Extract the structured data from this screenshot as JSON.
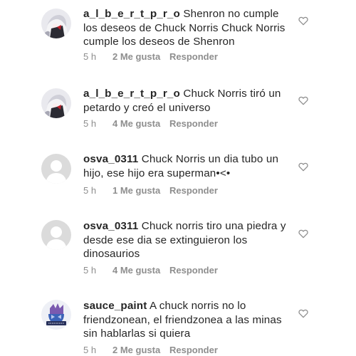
{
  "comments": [
    {
      "username": "a_l_b_e_r_t_p_r_o",
      "text": "Shenron no cumple los deseos de Chuck Norris Chuck Norris cumple los deseos de Shenron",
      "time": "5 h",
      "likes": "2 Me gusta",
      "reply": "Responder",
      "avatar": "anime-avatar"
    },
    {
      "username": "a_l_b_e_r_t_p_r_o",
      "text": "Chuck Norris tiró un petardo y creó el universo",
      "time": "5 h",
      "likes": "4 Me gusta",
      "reply": "Responder",
      "avatar": "anime-avatar"
    },
    {
      "username": "osva_0311",
      "text": "Chuck Norris un dia tubo un hijo, ese hijo era superman•<•",
      "time": "5 h",
      "likes": "1 Me gusta",
      "reply": "Responder",
      "avatar": "default-avatar"
    },
    {
      "username": "osva_0311",
      "text": "Chuck norris tiro una piedra y desde ese dia se extinguieron los dinosaurios",
      "time": "5 h",
      "likes": "4 Me gusta",
      "reply": "Responder",
      "avatar": "default-avatar"
    },
    {
      "username": "sauce_paint",
      "text": "A chuck norris no lo friendzonean, el friendzonea a las minas sin hablarlas si quiera",
      "time": "5 h",
      "likes": "2 Me gusta",
      "reply": "Responder",
      "avatar": "logo-avatar"
    }
  ],
  "icons": {
    "like": "heart-outline-icon"
  }
}
